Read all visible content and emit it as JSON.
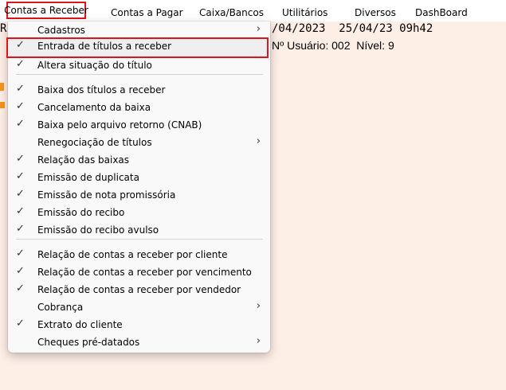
{
  "menubar": {
    "items": [
      {
        "label": "Contas a Receber"
      },
      {
        "label": "Contas a Pagar"
      },
      {
        "label": "Caixa/Bancos"
      },
      {
        "label": "Utilitários"
      },
      {
        "label": "Diversos"
      },
      {
        "label": "DashBoard"
      }
    ]
  },
  "background": {
    "left_char": "R",
    "dates": "/04/2023  25/04/23 09h42",
    "user_info": "Nº Usuário: 002  Nível: 9"
  },
  "dropdown": {
    "items": [
      {
        "label": "Cadastros",
        "checked": false,
        "submenu": true
      },
      {
        "label": "Entrada de títulos a receber",
        "checked": true,
        "submenu": false
      },
      {
        "label": "Altera situação do título",
        "checked": true,
        "submenu": false
      },
      {
        "label": "Baixa dos títulos a receber",
        "checked": true,
        "submenu": false
      },
      {
        "label": "Cancelamento da baixa",
        "checked": true,
        "submenu": false
      },
      {
        "label": "Baixa pelo arquivo retorno (CNAB)",
        "checked": true,
        "submenu": false
      },
      {
        "label": "Renegociação de títulos",
        "checked": false,
        "submenu": true
      },
      {
        "label": "Relação das baixas",
        "checked": true,
        "submenu": false
      },
      {
        "label": "Emissão de duplicata",
        "checked": true,
        "submenu": false
      },
      {
        "label": "Emissão de nota promissória",
        "checked": true,
        "submenu": false
      },
      {
        "label": "Emissão do recibo",
        "checked": true,
        "submenu": false
      },
      {
        "label": "Emissão do recibo avulso",
        "checked": true,
        "submenu": false
      },
      {
        "label": "Relação de contas a receber por cliente",
        "checked": true,
        "submenu": false
      },
      {
        "label": "Relação de contas a receber por vencimento",
        "checked": true,
        "submenu": false
      },
      {
        "label": "Relação de contas a receber por vendedor",
        "checked": true,
        "submenu": false
      },
      {
        "label": "Cobrança",
        "checked": false,
        "submenu": true
      },
      {
        "label": "Extrato do cliente",
        "checked": true,
        "submenu": false
      },
      {
        "label": "Cheques pré-datados",
        "checked": false,
        "submenu": true
      }
    ],
    "check_glyph": "✓",
    "chevron_glyph": "›"
  },
  "colors": {
    "highlight_border": "#e0141b",
    "background": "#fdeee6",
    "accent_orange": "#f7931d"
  }
}
